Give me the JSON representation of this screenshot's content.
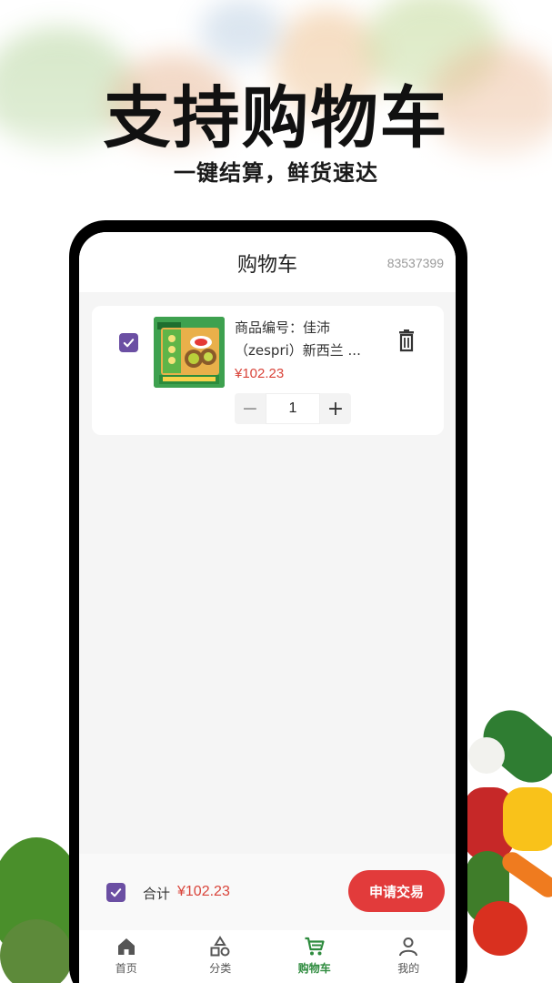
{
  "promo": {
    "headline": "支持购物车",
    "subline": "一键结算，鲜货速达"
  },
  "header": {
    "title": "购物车",
    "id": "83537399"
  },
  "cart": {
    "items": [
      {
        "checked": true,
        "name_line1": "商品编号：佳沛",
        "name_line2": "（zespri）新西兰 ...",
        "price": "¥102.23",
        "quantity": "1",
        "minus": "−",
        "plus": "+",
        "delete_icon": "trash-icon",
        "image_icon": "kiwi-gift-box"
      }
    ]
  },
  "checkout": {
    "all_checked": true,
    "total_label": "合计",
    "total_value": "¥102.23",
    "submit_label": "申请交易"
  },
  "tabs": [
    {
      "label": "首页",
      "icon": "home-icon",
      "active": false
    },
    {
      "label": "分类",
      "icon": "category-icon",
      "active": false
    },
    {
      "label": "购物车",
      "icon": "cart-icon",
      "active": true
    },
    {
      "label": "我的",
      "icon": "user-icon",
      "active": false
    }
  ],
  "colors": {
    "accent_green": "#2e8b3e",
    "price_red": "#d9443a",
    "button_red": "#e23b3b",
    "checkbox_purple": "#6b4fa3"
  }
}
